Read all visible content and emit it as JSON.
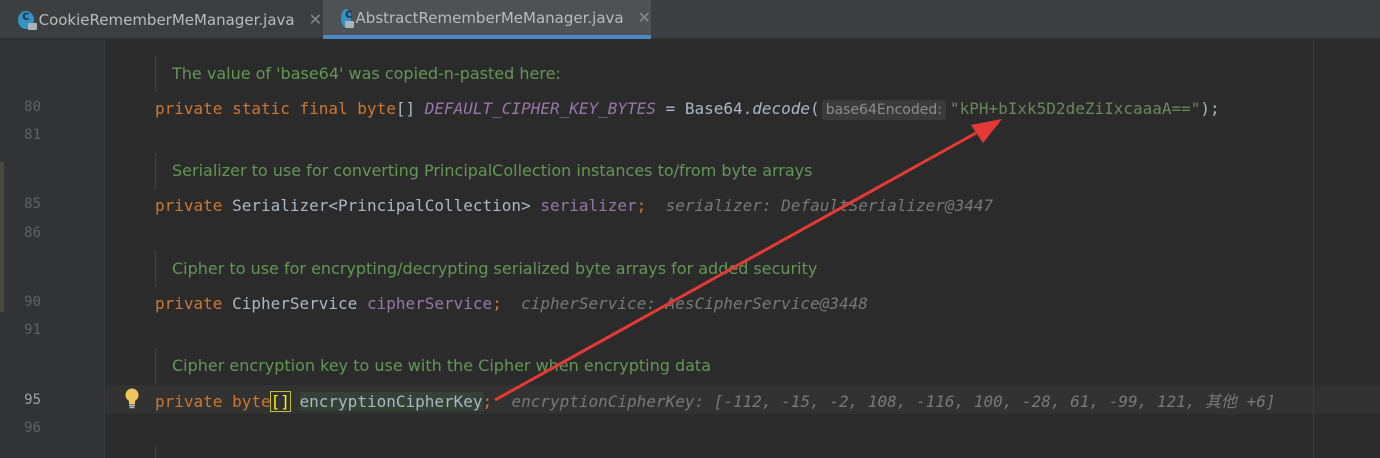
{
  "tabs": [
    {
      "name": "CookieRememberMeManager.java",
      "active": false
    },
    {
      "name": "AbstractRememberMeManager.java",
      "active": true
    }
  ],
  "close_glyph": "✕",
  "line_numbers": {
    "l80": "80",
    "l81": "81",
    "l85": "85",
    "l86": "86",
    "l90": "90",
    "l91": "91",
    "l95": "95",
    "l96": "96"
  },
  "docs": {
    "d1": "The value of 'base64' was copied-n-pasted here:",
    "d2": "Serializer to use for converting PrincipalCollection instances to/from byte arrays",
    "d3": "Cipher to use for encrypting/decrypting serialized byte arrays for added security",
    "d4": "Cipher encryption key to use with the Cipher when encrypting data",
    "d5": "Vertical cut-off doc comment (partially visible)"
  },
  "code": {
    "line80": {
      "kw1": "private static final",
      "type": "byte",
      "brackets": "[]",
      "const": "DEFAULT_CIPHER_KEY_BYTES",
      "eq": " = Base64.",
      "method": "decode",
      "open": "(",
      "param_hint": "base64Encoded:",
      "string": "\"kPH+bIxk5D2deZiIxcaaaA==\"",
      "close": ");"
    },
    "line85": {
      "kw": "private",
      "type": "Serializer<PrincipalCollection>",
      "field": "serializer",
      "semi": ";",
      "debug": "serializer: DefaultSerializer@3447"
    },
    "line90": {
      "kw": "private",
      "type": "CipherService",
      "field": "cipherService",
      "semi": ";",
      "debug": "cipherService: AesCipherService@3448"
    },
    "line95": {
      "kw": "private",
      "type": "byte",
      "brackets": "[]",
      "field": "encryptionCipherKey",
      "semi": ";",
      "debug": "encryptionCipherKey: [-112, -15, -2, 108, -116, 100, -28, 61, -99, 121, 其他 +6]"
    }
  },
  "colors": {
    "arrow": "#e53935",
    "doc_comment": "#629755",
    "keyword": "#cc7832",
    "field": "#9876aa",
    "string": "#6a8759"
  },
  "icons": [
    "java-class-icon",
    "close-icon",
    "lightbulb-icon"
  ]
}
